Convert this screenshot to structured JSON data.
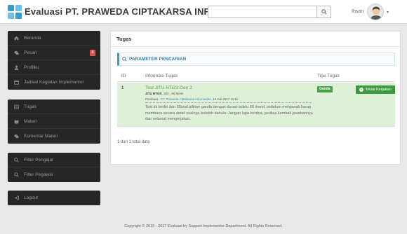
{
  "header": {
    "title": "Evaluasi PT. PRAWEDA CIPTAKARSA INFORMATIKA",
    "search_value": "",
    "user_name": "Ihsan",
    "caret": "▾"
  },
  "sidebar": {
    "groups": [
      {
        "items": [
          {
            "label": "Beranda",
            "icon": "home-icon"
          },
          {
            "label": "Pesan",
            "icon": "message-icon",
            "badge": "6"
          },
          {
            "label": "Profilku",
            "icon": "user-icon"
          },
          {
            "label": "Jadwal Kegiatan Implementor",
            "icon": "calendar-icon"
          }
        ]
      },
      {
        "items": [
          {
            "label": "Tugas",
            "icon": "task-icon"
          },
          {
            "label": "Materi",
            "icon": "book-icon"
          },
          {
            "label": "Komentar Materi",
            "icon": "comment-icon"
          }
        ]
      },
      {
        "items": [
          {
            "label": "Filter Pengajar",
            "icon": "search-icon"
          },
          {
            "label": "Filter Pegawai",
            "icon": "search-icon"
          }
        ]
      },
      {
        "items": [
          {
            "label": "Logout",
            "icon": "logout-icon"
          }
        ]
      }
    ]
  },
  "main": {
    "heading": "Tugas",
    "search_param": "PARAMETER PENCARIAN",
    "columns": [
      "ID",
      "Informasi Tugas",
      "Tipe Tugas"
    ],
    "task": {
      "id": "1",
      "title": "Test JITU RTGS Gen 2",
      "meta_code": "JITU RTGS",
      "meta_rest": ", S/D , 60 Menit",
      "creator_label": "Pembuat : ",
      "creator_link": "PT. Praweda Ciptakarsa Informatika",
      "creator_date": ", 14 Juli 2017 11:11",
      "description": "Test ini terdiri dari 30soal pilihan ganda dengan durasi waktu 60 menit, sebelum menjawab harap membaca secara detail soalnya terlebih dahulu. Jangan lupa berdoa, periksa kembali jawabannya dan selamat mengerjakan.",
      "type": "Ganda",
      "start_label": "Mulai Kerjakan"
    },
    "total": "1 dari 1 total data"
  },
  "footer": {
    "copyright": "Copyright © 2016 - 2017 Evaluasi by Support Implementor Department. All Rights Reserved."
  },
  "colors": {
    "accent": "#3a9cc9",
    "success": "#3e9a3e",
    "row_bg": "#dff0d8",
    "sidebar_bg": "#262626",
    "badge_red": "#d9534f"
  }
}
